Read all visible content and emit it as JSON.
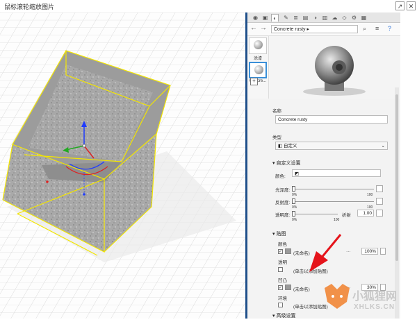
{
  "window": {
    "title": "鼠标滚轮缩放图片"
  },
  "panel": {
    "breadcrumb": "Concrete rusty",
    "thumbs": [
      {
        "label": "涂漆"
      },
      {
        "label": "Concre..."
      }
    ],
    "sections": {
      "name_label": "名称",
      "name_value": "Concrete rusty",
      "type_label": "类型",
      "type_value": "自定义",
      "custom_settings": "自定义设置",
      "color_label": "颜色:",
      "glossiness_label": "光泽度:",
      "reflectance_label": "反射度:",
      "transparency_label": "透明度:",
      "refraction_label": "折射",
      "refraction_value": "1.00",
      "maps": "贴图",
      "map_color": "颜色",
      "map_color_value": "(未命名)",
      "map_color_pct": "100%",
      "map_transparency": "透明",
      "map_transparency_value": "(单击以添加贴图)",
      "map_bump": "凹凸",
      "map_bump_value": "(未命名)",
      "map_bump_pct": "30%",
      "map_env": "环境",
      "map_env_value": "(单击以添加贴图)",
      "advanced": "高级设置",
      "slider_min": "0%",
      "slider_max": "100"
    }
  },
  "watermark": {
    "brand": "小狐狸网",
    "domain": "XHLKS.CN"
  }
}
